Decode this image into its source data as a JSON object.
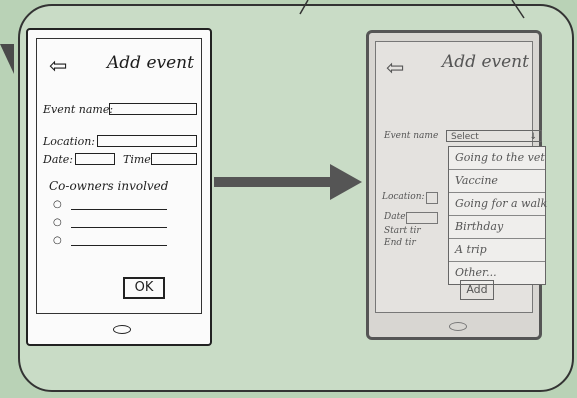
{
  "left_screen": {
    "title": "Add event",
    "back_icon": "arrow-left-icon",
    "event_name_label": "Event name:",
    "location_label": "Location:",
    "date_label": "Date:",
    "time_label": "Time",
    "co_owners_label": "Co-owners involved",
    "ok_label": "OK"
  },
  "right_screen": {
    "title": "Add event",
    "back_icon": "arrow-left-icon",
    "event_name_label": "Event name",
    "select_value": "Select",
    "options": [
      "Going to the vet",
      "Vaccine",
      "Going for a walk",
      "Birthday",
      "A trip",
      "Other..."
    ],
    "location_label": "Location:",
    "date_label": "Date",
    "start_time_label": "Start tir",
    "end_time_label": "End tir",
    "add_label": "Add"
  },
  "colors": {
    "background": "#b9d2b6",
    "ink": "#1d1d1d",
    "arrow": "#555555"
  }
}
